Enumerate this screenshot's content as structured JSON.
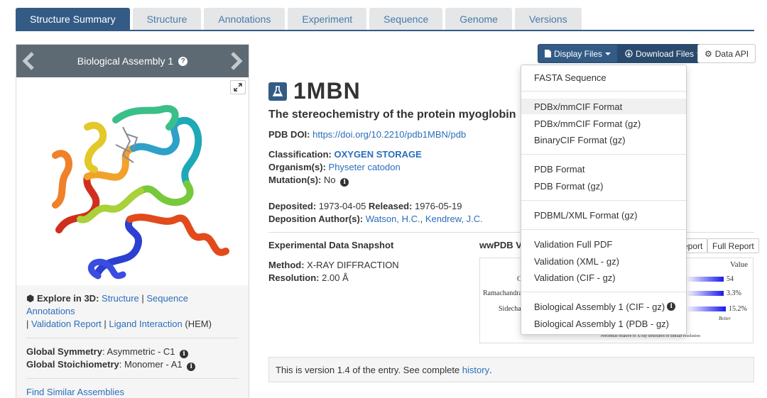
{
  "tabs": [
    "Structure Summary",
    "Structure",
    "Annotations",
    "Experiment",
    "Sequence",
    "Genome",
    "Versions"
  ],
  "left_panel": {
    "header": "Biological Assembly 1",
    "help_icon": "?",
    "explore_label": "Explore in 3D",
    "explore_links": [
      "Structure",
      "Sequence Annotations",
      "Validation Report",
      "Ligand Interaction"
    ],
    "ligand_suffix": "(HEM)",
    "global_symmetry_label": "Global Symmetry",
    "global_symmetry_value": "Asymmetric - C1",
    "global_stoich_label": "Global Stoichiometry",
    "global_stoich_value": "Monomer - A1",
    "find_similar": "Find Similar Assemblies"
  },
  "buttons": {
    "display_files": "Display Files",
    "download_files": "Download Files",
    "data_api": "Data API"
  },
  "entry": {
    "id": "1MBN",
    "title": "The stereochemistry of the protein myoglobin",
    "doi_label": "PDB DOI:",
    "doi_value": "https://doi.org/10.2210/pdb1MBN/pdb",
    "classification_label": "Classification:",
    "classification_value": "OXYGEN STORAGE",
    "organism_label": "Organism(s):",
    "organism_value": "Physeter catodon",
    "mutation_label": "Mutation(s):",
    "mutation_value": "No",
    "deposited_label": "Deposited:",
    "deposited_value": "1973-04-05",
    "released_label": "Released:",
    "released_value": "1976-05-19",
    "authors_label": "Deposition Author(s):",
    "authors": [
      "Watson, H.C.",
      "Kendrew, J.C."
    ]
  },
  "experiment": {
    "heading": "Experimental Data Snapshot",
    "method_label": "Method:",
    "method_value": "X-RAY DIFFRACTION",
    "resolution_label": "Resolution:",
    "resolution_value": "2.00 Å"
  },
  "validation": {
    "heading": "wwPDB V",
    "report_btn": "eport",
    "full_report_btn": "Full Report",
    "value_header": "Value",
    "rows": [
      {
        "label": "C",
        "value": "54",
        "fill": 0.85
      },
      {
        "label": "Ramachandra",
        "value": "3.3%",
        "fill": 0.85
      },
      {
        "label": "Sidechai",
        "value": "15.2%",
        "fill": 0.9
      }
    ],
    "better": "Better",
    "footnote": "Percentile relative to X-ray structures of similar resolution"
  },
  "version_text": "This is version 1.4 of the entry. See complete",
  "version_link": "history",
  "version_end": ".",
  "dropdown": {
    "items": [
      "FASTA Sequence",
      "PDBx/mmCIF Format",
      "PDBx/mmCIF Format (gz)",
      "BinaryCIF Format (gz)",
      "PDB Format",
      "PDB Format (gz)",
      "PDBML/XML Format (gz)",
      "Validation Full PDF",
      "Validation (XML - gz)",
      "Validation (CIF - gz)",
      "Biological Assembly 1 (CIF - gz)",
      "Biological Assembly 1 (PDB - gz)"
    ],
    "highlighted": "PDBx/mmCIF Format"
  },
  "colors": {
    "accent": "#335b86",
    "link": "#2a6ebb",
    "tab_bg": "#e4e6e8",
    "panel_header": "#5e6a73"
  }
}
